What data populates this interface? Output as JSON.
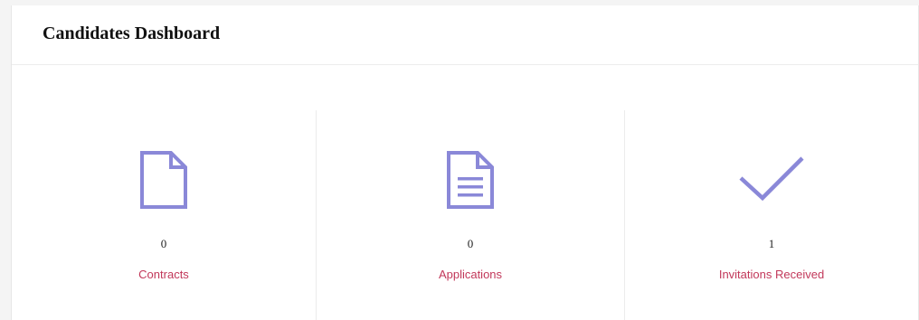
{
  "header": {
    "title": "Candidates Dashboard"
  },
  "colors": {
    "icon": "#8a88d8",
    "label": "#c2385a"
  },
  "stats": [
    {
      "icon": "file-icon",
      "count": "0",
      "label": "Contracts"
    },
    {
      "icon": "file-text-icon",
      "count": "0",
      "label": "Applications"
    },
    {
      "icon": "checkmark-icon",
      "count": "1",
      "label": "Invitations Received"
    }
  ]
}
